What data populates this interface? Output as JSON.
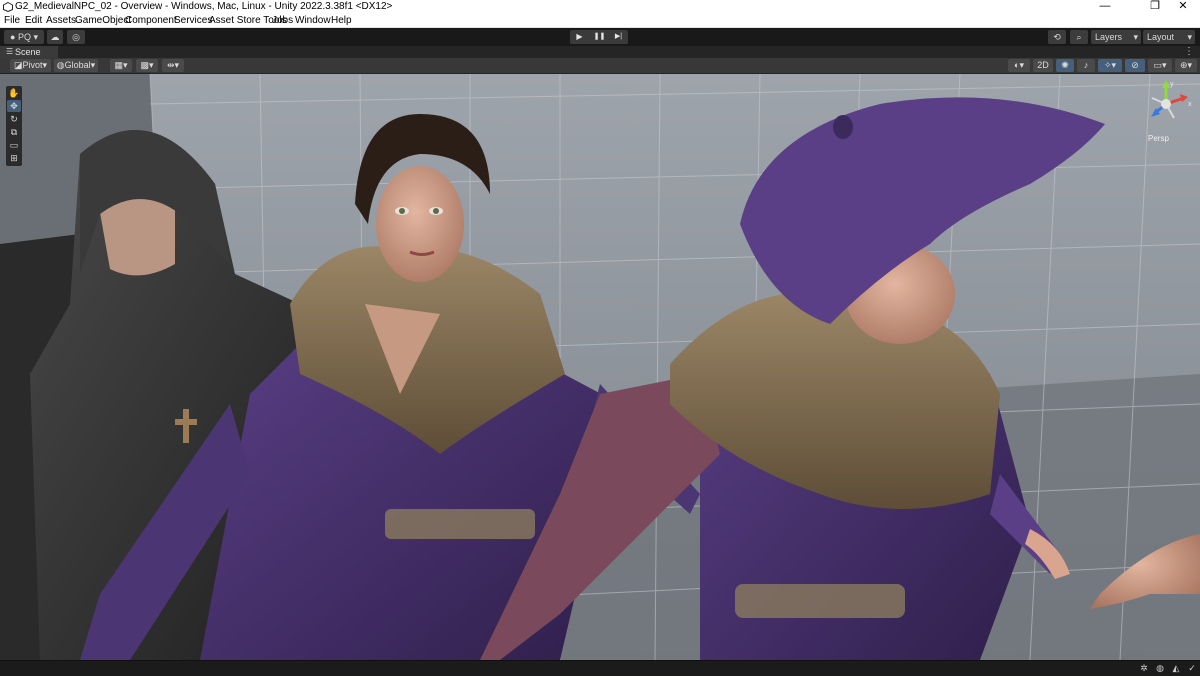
{
  "window": {
    "title": "G2_MedievalNPC_02 - Overview - Windows, Mac, Linux - Unity 2022.3.38f1 <DX12>",
    "controls": {
      "minimize": "—",
      "maximize": "❐",
      "close": "✕"
    }
  },
  "menu": [
    "File",
    "Edit",
    "Assets",
    "GameObject",
    "Component",
    "Services",
    "Asset Store Tools",
    "Jobs",
    "Window",
    "Help"
  ],
  "toolbar": {
    "account_label": "PQ",
    "play_icon": "▶",
    "pause_icon": "❚❚",
    "step_icon": "▶|",
    "layers_label": "Layers",
    "layout_label": "Layout",
    "history_icon": "⟲",
    "search_icon": "⌕"
  },
  "scene_tab": {
    "label": "Scene",
    "menu_icon": "☰",
    "more_icon": "⋮"
  },
  "scene_toolbar": {
    "pivot_label": "Pivot",
    "global_label": "Global",
    "twod_label": "2D",
    "more_icon": "⋮"
  },
  "tools": [
    "hand-icon",
    "move-icon",
    "rotate-icon",
    "scale-icon",
    "rect-icon",
    "transform-icon"
  ],
  "gizmo": {
    "mode_label": "Persp",
    "y_label": "y",
    "x_label": "x"
  },
  "colors": {
    "accent": "#46607c",
    "toolbar": "#191919",
    "grid_floor": "#8a8f96"
  }
}
